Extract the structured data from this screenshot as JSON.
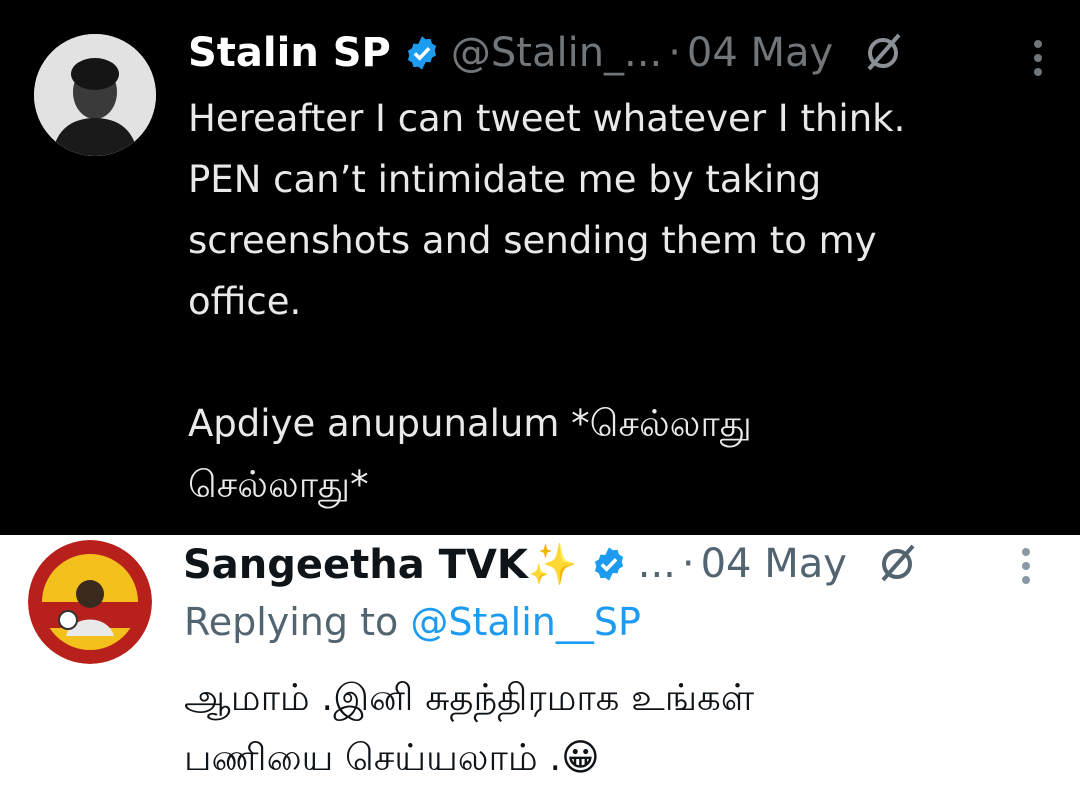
{
  "tweets": [
    {
      "display_name": "Stalin SP",
      "handle": "@Stalin_...",
      "separator": "·",
      "date": "04 May",
      "text": "Hereafter I can tweet whatever I think.\nPEN can’t intimidate me by taking\nscreenshots and sending them to my\noffice.\n\nApdiye anupunalum *செல்லாது\nசெல்லாது*"
    },
    {
      "display_name": "Sangeetha TVK✨",
      "handle": "...",
      "separator": "·",
      "date": "04 May",
      "reply_prefix": "Replying to",
      "reply_handle": "@Stalin__SP",
      "text": "ஆமாம் .இனி சுதந்திரமாக உங்கள்\nபணியை செய்யலாம் .😀"
    }
  ],
  "icons": {
    "verified": "verified-badge-icon",
    "grok": "grok-icon",
    "more": "more-options-icon"
  },
  "colors": {
    "dark_bg": "#000000",
    "light_bg": "#ffffff",
    "verified_blue": "#1d9bf0",
    "link_blue": "#1d9bf0",
    "muted_dark": "#71767b",
    "muted_light": "#536471"
  }
}
